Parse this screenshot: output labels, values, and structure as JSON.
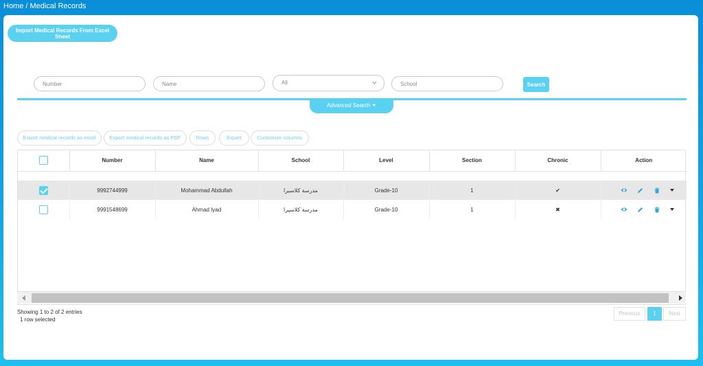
{
  "breadcrumb": {
    "home": "Home",
    "sep": " / ",
    "current": "Medical Records"
  },
  "import_button": "Import Medical Records From Excel Sheet",
  "filters": {
    "number_placeholder": "Number",
    "name_placeholder": "Name",
    "level_selected": "All",
    "school_placeholder": "School",
    "search_label": "Search"
  },
  "advanced_search": "Advanced Search ⏷",
  "toolbar": {
    "export_excel": "Export medical records as excel",
    "export_pdf": "Export medical records as PDF",
    "rows": "Rows",
    "export": "Export",
    "customize": "Customize columns"
  },
  "table": {
    "headers": {
      "number": "Number",
      "name": "Name",
      "school": "School",
      "level": "Level",
      "section": "Section",
      "chronic": "Chronic",
      "action": "Action"
    },
    "rows": [
      {
        "selected": true,
        "number": "9992744999",
        "name": "Mohammad Abdullah",
        "school": "مدرسة كلاسيرا",
        "level": "Grade-10",
        "section": "1",
        "chronic": "✔"
      },
      {
        "selected": false,
        "number": "9991548699",
        "name": "Ahmad Iyad",
        "school": "مدرسة كلاسيرا",
        "level": "Grade-10",
        "section": "1",
        "chronic": "✖"
      }
    ]
  },
  "footer": {
    "showing": "Showing 1 to 2 of 2 entries",
    "selected": "1 row selected",
    "previous": "Previous",
    "page": "1",
    "next": "Next"
  },
  "colors": {
    "accent": "#5bd1f2",
    "header_bg": "#0a8ed8",
    "action_icon": "#2aa7e0"
  },
  "icons": {
    "view": "eye-icon",
    "edit": "pencil-icon",
    "delete": "trash-icon",
    "more": "caret-down-icon"
  }
}
